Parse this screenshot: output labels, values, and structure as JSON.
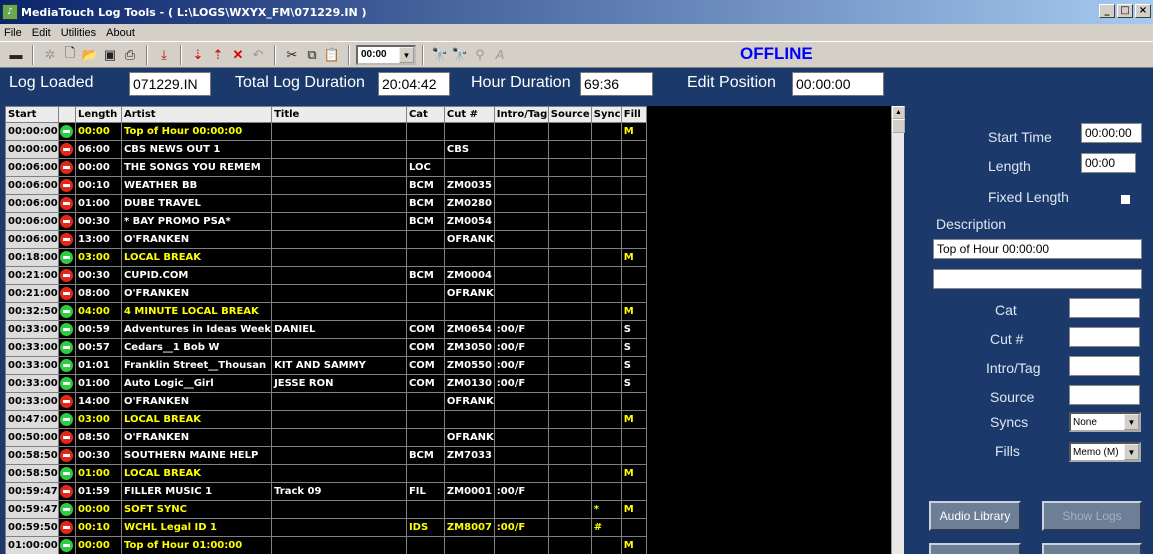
{
  "window": {
    "title": "MediaTouch Log Tools - ( L:\\LOGS\\WXYX_FM\\071229.IN )",
    "minimize": "_",
    "maximize": "□",
    "close": "×"
  },
  "menu": [
    "File",
    "Edit",
    "Utilities",
    "About"
  ],
  "toolbar": {
    "time_combo": "00:00",
    "status": "OFFLINE"
  },
  "header": {
    "log_loaded_label": "Log Loaded",
    "log_loaded_value": "071229.IN",
    "total_log_duration_label": "Total Log Duration",
    "total_log_duration_value": "20:04:42",
    "hour_duration_label": "Hour Duration",
    "hour_duration_value": "69:36",
    "edit_position_label": "Edit Position",
    "edit_position_value": "00:00:00"
  },
  "grid": {
    "columns": [
      "Start",
      "",
      "Length",
      "Artist",
      "Title",
      "Cat",
      "Cut #",
      "Intro/Tag",
      "Source",
      "Sync",
      "Fill"
    ],
    "rows": [
      {
        "start": "00:00:00",
        "ind": "green",
        "length": "00:00",
        "artist": "Top of Hour 00:00:00",
        "title": "",
        "cat": "",
        "cut": "",
        "intro": "",
        "source": "",
        "sync": "",
        "fill": "M",
        "yellow": true
      },
      {
        "start": "00:00:00",
        "ind": "red",
        "length": "06:00",
        "artist": "CBS NEWS OUT 1",
        "title": "",
        "cat": "",
        "cut": "CBS",
        "intro": "",
        "source": "",
        "sync": "",
        "fill": "",
        "yellow": false
      },
      {
        "start": "00:06:00",
        "ind": "red",
        "length": "00:00",
        "artist": "THE SONGS YOU REMEM",
        "title": "",
        "cat": "LOC",
        "cut": "",
        "intro": "",
        "source": "",
        "sync": "",
        "fill": "",
        "yellow": false
      },
      {
        "start": "00:06:00",
        "ind": "red",
        "length": "00:10",
        "artist": "WEATHER BB",
        "title": "",
        "cat": "BCM",
        "cut": "ZM0035",
        "intro": "",
        "source": "",
        "sync": "",
        "fill": "",
        "yellow": false
      },
      {
        "start": "00:06:00",
        "ind": "red",
        "length": "01:00",
        "artist": "DUBE TRAVEL",
        "title": "",
        "cat": "BCM",
        "cut": "ZM0280",
        "intro": "",
        "source": "",
        "sync": "",
        "fill": "",
        "yellow": false
      },
      {
        "start": "00:06:00",
        "ind": "red",
        "length": "00:30",
        "artist": "* BAY PROMO PSA*",
        "title": "",
        "cat": "BCM",
        "cut": "ZM0054",
        "intro": "",
        "source": "",
        "sync": "",
        "fill": "",
        "yellow": false
      },
      {
        "start": "00:06:00",
        "ind": "red",
        "length": "13:00",
        "artist": "O'FRANKEN",
        "title": "",
        "cat": "",
        "cut": "OFRANK",
        "intro": "",
        "source": "",
        "sync": "",
        "fill": "",
        "yellow": false
      },
      {
        "start": "00:18:00",
        "ind": "green",
        "length": "03:00",
        "artist": "LOCAL BREAK",
        "title": "",
        "cat": "",
        "cut": "",
        "intro": "",
        "source": "",
        "sync": "",
        "fill": "M",
        "yellow": true
      },
      {
        "start": "00:21:00",
        "ind": "red",
        "length": "00:30",
        "artist": "CUPID.COM",
        "title": "",
        "cat": "BCM",
        "cut": "ZM0004",
        "intro": "",
        "source": "",
        "sync": "",
        "fill": "",
        "yellow": false
      },
      {
        "start": "00:21:00",
        "ind": "red",
        "length": "08:00",
        "artist": "O'FRANKEN",
        "title": "",
        "cat": "",
        "cut": "OFRANK",
        "intro": "",
        "source": "",
        "sync": "",
        "fill": "",
        "yellow": false
      },
      {
        "start": "00:32:50",
        "ind": "green",
        "length": "04:00",
        "artist": "4 MINUTE LOCAL BREAK",
        "title": "",
        "cat": "",
        "cut": "",
        "intro": "",
        "source": "",
        "sync": "",
        "fill": "M",
        "yellow": true
      },
      {
        "start": "00:33:00",
        "ind": "green",
        "length": "00:59",
        "artist": "Adventures in Ideas Week",
        "title": "DANIEL",
        "cat": "COM",
        "cut": "ZM0654",
        "intro": ":00/F",
        "source": "",
        "sync": "",
        "fill": "S",
        "yellow": false
      },
      {
        "start": "00:33:00",
        "ind": "green",
        "length": "00:57",
        "artist": "Cedars__1 Bob W",
        "title": "",
        "cat": "COM",
        "cut": "ZM3050",
        "intro": ":00/F",
        "source": "",
        "sync": "",
        "fill": "S",
        "yellow": false
      },
      {
        "start": "00:33:00",
        "ind": "green",
        "length": "01:01",
        "artist": "Franklin Street__Thousan",
        "title": "KIT AND SAMMY",
        "cat": "COM",
        "cut": "ZM0550",
        "intro": ":00/F",
        "source": "",
        "sync": "",
        "fill": "S",
        "yellow": false
      },
      {
        "start": "00:33:00",
        "ind": "green",
        "length": "01:00",
        "artist": "Auto Logic__Girl",
        "title": "JESSE RON",
        "cat": "COM",
        "cut": "ZM0130",
        "intro": ":00/F",
        "source": "",
        "sync": "",
        "fill": "S",
        "yellow": false
      },
      {
        "start": "00:33:00",
        "ind": "red",
        "length": "14:00",
        "artist": "O'FRANKEN",
        "title": "",
        "cat": "",
        "cut": "OFRANK",
        "intro": "",
        "source": "",
        "sync": "",
        "fill": "",
        "yellow": false
      },
      {
        "start": "00:47:00",
        "ind": "green",
        "length": "03:00",
        "artist": "LOCAL BREAK",
        "title": "",
        "cat": "",
        "cut": "",
        "intro": "",
        "source": "",
        "sync": "",
        "fill": "M",
        "yellow": true
      },
      {
        "start": "00:50:00",
        "ind": "red",
        "length": "08:50",
        "artist": "O'FRANKEN",
        "title": "",
        "cat": "",
        "cut": "OFRANK",
        "intro": "",
        "source": "",
        "sync": "",
        "fill": "",
        "yellow": false
      },
      {
        "start": "00:58:50",
        "ind": "red",
        "length": "00:30",
        "artist": "SOUTHERN MAINE HELP",
        "title": "",
        "cat": "BCM",
        "cut": "ZM7033",
        "intro": "",
        "source": "",
        "sync": "",
        "fill": "",
        "yellow": false
      },
      {
        "start": "00:58:50",
        "ind": "green",
        "length": "01:00",
        "artist": "LOCAL BREAK",
        "title": "",
        "cat": "",
        "cut": "",
        "intro": "",
        "source": "",
        "sync": "",
        "fill": "M",
        "yellow": true
      },
      {
        "start": "00:59:47",
        "ind": "red",
        "length": "01:59",
        "artist": "FILLER MUSIC 1",
        "title": "Track 09",
        "cat": "FIL",
        "cut": "ZM0001",
        "intro": ":00/F",
        "source": "",
        "sync": "",
        "fill": "",
        "yellow": false
      },
      {
        "start": "00:59:47",
        "ind": "green",
        "length": "00:00",
        "artist": "SOFT SYNC",
        "title": "",
        "cat": "",
        "cut": "",
        "intro": "",
        "source": "",
        "sync": "*",
        "fill": "M",
        "yellow": true
      },
      {
        "start": "00:59:50",
        "ind": "red",
        "length": "00:10",
        "artist": "WCHL Legal ID 1",
        "title": "",
        "cat": "IDS",
        "cut": "ZM8007",
        "intro": ":00/F",
        "source": "",
        "sync": "#",
        "fill": "",
        "yellow": true
      },
      {
        "start": "01:00:00",
        "ind": "green",
        "length": "00:00",
        "artist": "Top of Hour 01:00:00",
        "title": "",
        "cat": "",
        "cut": "",
        "intro": "",
        "source": "",
        "sync": "",
        "fill": "M",
        "yellow": true
      }
    ]
  },
  "panel": {
    "start_time_label": "Start Time",
    "start_time_value": "00:00:00",
    "length_label": "Length",
    "length_value": "00:00",
    "fixed_length_label": "Fixed Length",
    "description_label": "Description",
    "description_value": "Top of Hour 00:00:00",
    "description2_value": "",
    "cat_label": "Cat",
    "cut_label": "Cut #",
    "intro_tag_label": "Intro/Tag",
    "source_label": "Source",
    "syncs_label": "Syncs",
    "syncs_value": "None",
    "fills_label": "Fills",
    "fills_value": "Memo (M)",
    "audio_library_button": "Audio Library",
    "show_logs_button": "Show Logs"
  },
  "colors": {
    "background": "#1b3a6b",
    "grid_background": "#000000",
    "highlight_text": "#ffff00",
    "offline": "#0000ff",
    "indicator_green": "#2ecc40",
    "indicator_red": "#e4271c"
  }
}
